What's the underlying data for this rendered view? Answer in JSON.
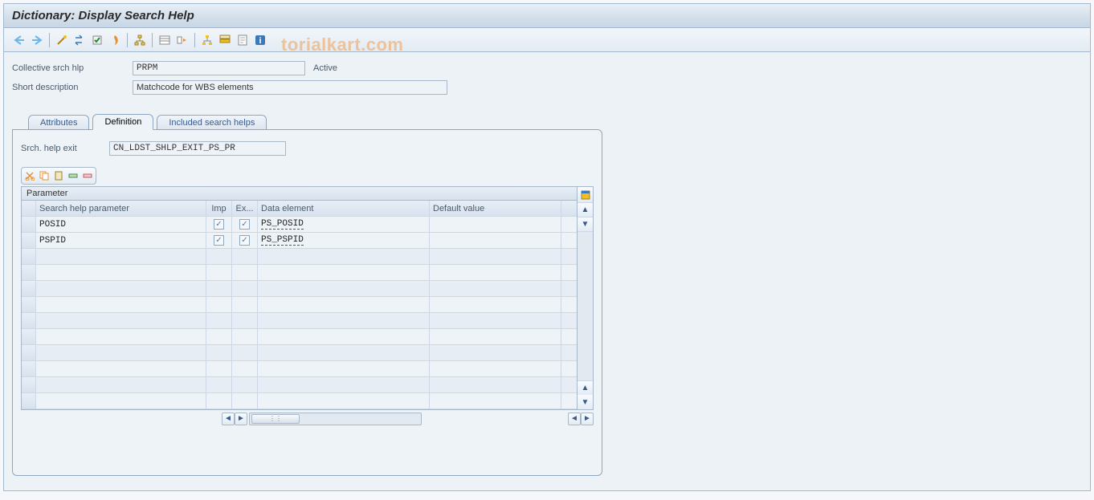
{
  "title": "Dictionary: Display Search Help",
  "watermark": "torialkart.com",
  "header": {
    "srch_label": "Collective srch hlp",
    "srch_value": "PRPM",
    "status": "Active",
    "desc_label": "Short description",
    "desc_value": "Matchcode for WBS elements"
  },
  "tabs": {
    "attributes": "Attributes",
    "definition": "Definition",
    "included": "Included search helps"
  },
  "definition": {
    "exit_label": "Srch. help exit",
    "exit_value": "CN_LDST_SHLP_EXIT_PS_PR"
  },
  "grid": {
    "title": "Parameter",
    "columns": {
      "param": "Search help parameter",
      "imp": "Imp",
      "exp": "Ex...",
      "de": "Data element",
      "def": "Default value"
    },
    "rows": [
      {
        "param": "POSID",
        "imp": true,
        "exp": true,
        "de": "PS_POSID",
        "def": ""
      },
      {
        "param": "PSPID",
        "imp": true,
        "exp": true,
        "de": "PS_PSPID",
        "def": ""
      }
    ]
  }
}
